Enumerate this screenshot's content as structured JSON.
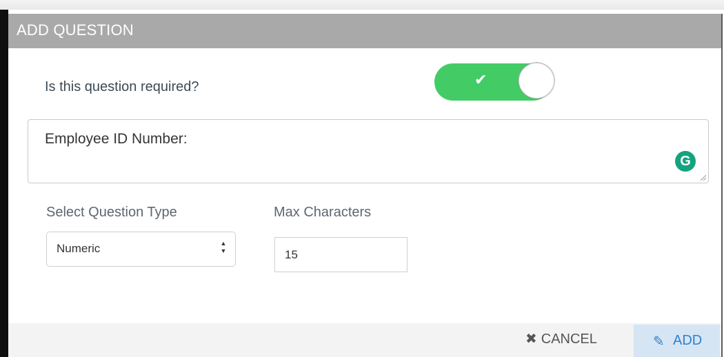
{
  "dialog": {
    "title": "ADD QUESTION",
    "required_label": "Is this question required?",
    "required_toggle": {
      "on": true,
      "icon": "check-icon"
    },
    "question_text": "Employee ID Number:",
    "question_type_label": "Select Question Type",
    "question_type_value": "Numeric",
    "max_chars_label": "Max Characters",
    "max_chars_value": "15",
    "cancel_label": "CANCEL",
    "add_label": "ADD"
  },
  "colors": {
    "header": "#a9a9a9",
    "toggle_on": "#43cc66",
    "add_button_bg": "#d6e5f3",
    "add_button_text": "#2f7fd0",
    "grammarly": "#14a37f"
  }
}
